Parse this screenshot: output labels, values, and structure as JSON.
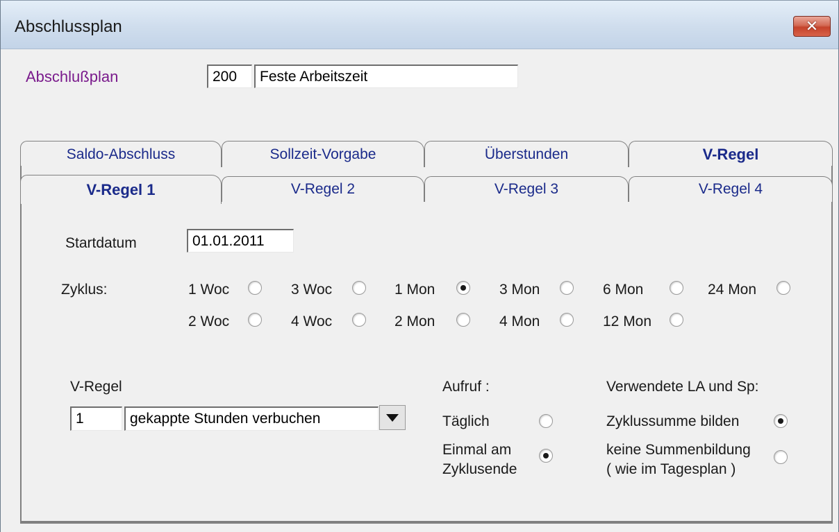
{
  "window": {
    "title": "Abschlussplan",
    "close_glyph": "✕"
  },
  "plan": {
    "label": "Abschlußplan",
    "number": "200",
    "name": "Feste Arbeitszeit"
  },
  "tabs_top": [
    {
      "label": "Saldo-Abschluss",
      "active": false
    },
    {
      "label": "Sollzeit-Vorgabe",
      "active": false
    },
    {
      "label": "Überstunden",
      "active": false
    },
    {
      "label": "V-Regel",
      "active": true
    }
  ],
  "tabs_sub": [
    {
      "label": "V-Regel 1",
      "active": true
    },
    {
      "label": "V-Regel 2",
      "active": false
    },
    {
      "label": "V-Regel 3",
      "active": false
    },
    {
      "label": "V-Regel 4",
      "active": false
    }
  ],
  "startdatum": {
    "label": "Startdatum",
    "value": "01.01.2011"
  },
  "zyklus": {
    "label": "Zyklus:",
    "selected": "1 Mon",
    "options": [
      "1 Woc",
      "3 Woc",
      "1 Mon",
      "3 Mon",
      "6 Mon",
      "24 Mon",
      "2 Woc",
      "4 Woc",
      "2 Mon",
      "4 Mon",
      "12 Mon"
    ]
  },
  "vregel": {
    "label": "V-Regel",
    "number": "1",
    "selected": "gekappte Stunden verbuchen"
  },
  "aufruf": {
    "label": "Aufruf :",
    "option_daily": "Täglich",
    "option_end_line1": "Einmal am",
    "option_end_line2": "Zyklusende",
    "selected": "Einmal am Zyklusende"
  },
  "verwendete": {
    "label": "Verwendete LA und Sp:",
    "option_sum": "Zyklussumme bilden",
    "option_none_line1": "keine Summenbildung",
    "option_none_line2": "( wie im Tagesplan )",
    "selected": "Zyklussumme bilden"
  },
  "icons": {
    "close": "close-icon",
    "dropdown": "chevron-down-icon"
  }
}
